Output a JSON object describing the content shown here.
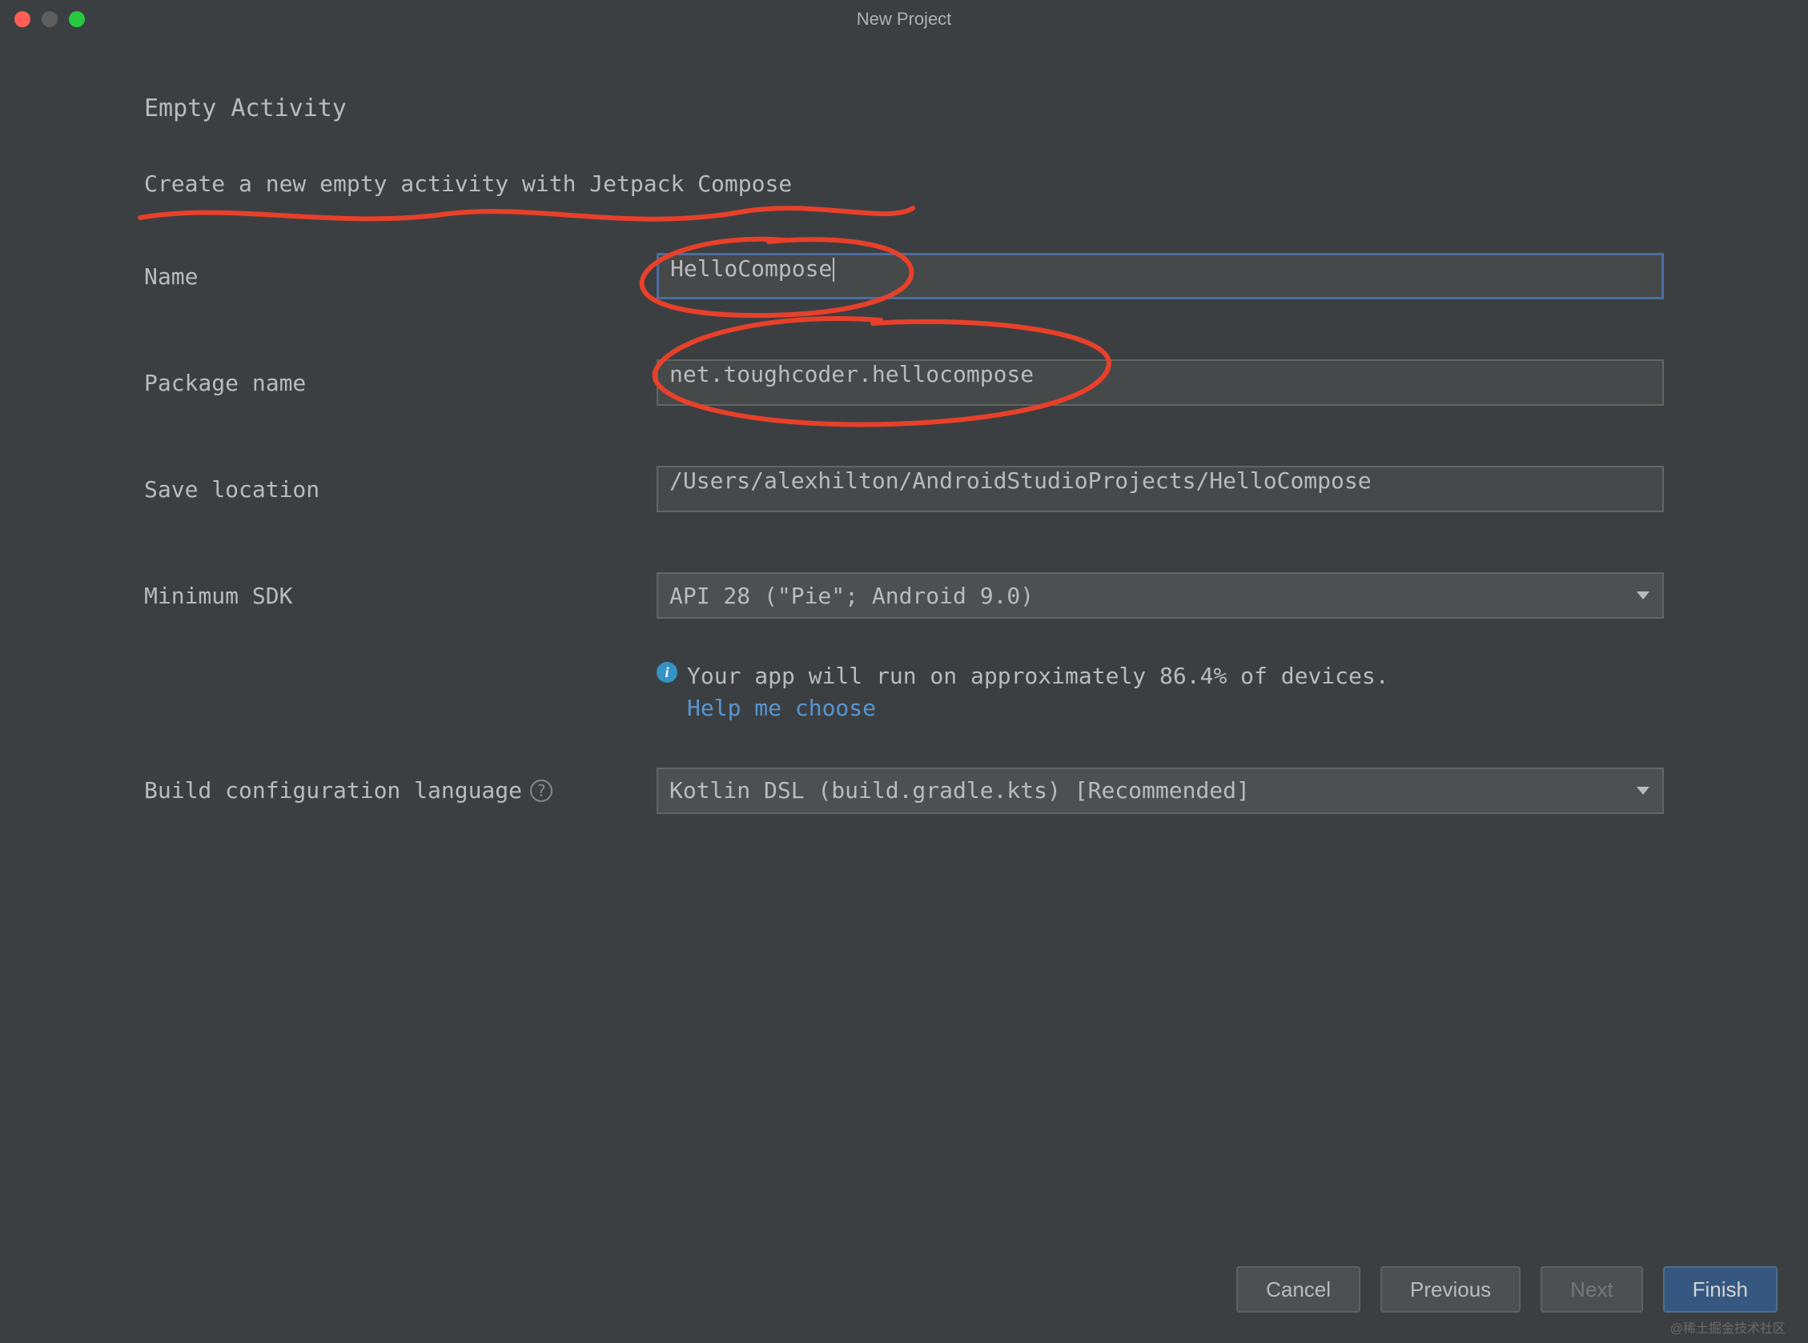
{
  "window": {
    "title": "New Project"
  },
  "heading": "Empty Activity",
  "subheading": "Create a new empty activity with Jetpack Compose",
  "form": {
    "name": {
      "label": "Name",
      "value": "HelloCompose"
    },
    "package": {
      "label": "Package name",
      "value": "net.toughcoder.hellocompose"
    },
    "save_location": {
      "label": "Save location",
      "value": "/Users/alexhilton/AndroidStudioProjects/HelloCompose"
    },
    "min_sdk": {
      "label": "Minimum SDK",
      "value": "API 28 (\"Pie\"; Android 9.0)"
    },
    "info": {
      "text": "Your app will run on approximately 86.4% of devices.",
      "help": "Help me choose"
    },
    "build_lang": {
      "label": "Build configuration language",
      "value": "Kotlin DSL (build.gradle.kts) [Recommended]"
    }
  },
  "buttons": {
    "cancel": "Cancel",
    "previous": "Previous",
    "next": "Next",
    "finish": "Finish"
  },
  "watermark": "@稀土掘金技术社区"
}
